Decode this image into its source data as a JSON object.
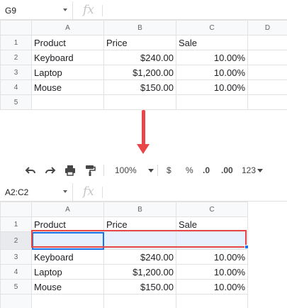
{
  "top": {
    "namebox": "G9",
    "fx": "fx",
    "columns": [
      "A",
      "B",
      "C",
      "D"
    ],
    "rows": [
      {
        "num": "1",
        "a": "Product",
        "b": "Price",
        "c": "Sale"
      },
      {
        "num": "2",
        "a": "Keyboard",
        "b": "$240.00",
        "c": "10.00%"
      },
      {
        "num": "3",
        "a": "Laptop",
        "b": "$1,200.00",
        "c": "10.00%"
      },
      {
        "num": "4",
        "a": "Mouse",
        "b": "$150.00",
        "c": "10.00%"
      },
      {
        "num": "5",
        "a": "",
        "b": "",
        "c": ""
      }
    ]
  },
  "toolbar": {
    "zoom": "100%",
    "currency": "$",
    "percent": "%",
    "decrease_decimal": ".0",
    "increase_decimal": ".00",
    "more_formats": "123"
  },
  "bottom": {
    "namebox": "A2:C2",
    "fx": "fx",
    "columns": [
      "A",
      "B",
      "C"
    ],
    "rows": [
      {
        "num": "1",
        "a": "Product",
        "b": "Price",
        "c": "Sale"
      },
      {
        "num": "2",
        "a": "",
        "b": "",
        "c": ""
      },
      {
        "num": "3",
        "a": "Keyboard",
        "b": "$240.00",
        "c": "10.00%"
      },
      {
        "num": "4",
        "a": "Laptop",
        "b": "$1,200.00",
        "c": "10.00%"
      },
      {
        "num": "5",
        "a": "Mouse",
        "b": "$150.00",
        "c": "10.00%"
      }
    ]
  },
  "colors": {
    "highlight": "#e74748",
    "selection": "#1a73e8",
    "header_bg": "#f8f9fa"
  }
}
